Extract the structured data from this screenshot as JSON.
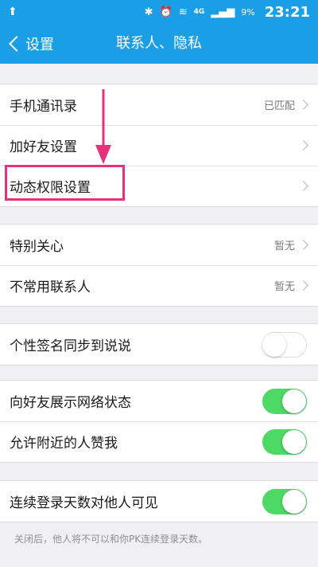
{
  "status_bar": {
    "upload_glyph": "⬆",
    "bluetooth_glyph": "✱",
    "alarm_glyph": "⏰",
    "wifi_glyph": "≋",
    "network_label": "4G",
    "signal_glyph": "▂▄▆",
    "battery": "9%",
    "time": "23:21"
  },
  "nav": {
    "back_label": "设置",
    "title": "联系人、隐私"
  },
  "groups": {
    "contacts": [
      {
        "label": "手机通讯录",
        "value": "已匹配"
      },
      {
        "label": "加好友设置",
        "value": ""
      },
      {
        "label": "动态权限设置",
        "value": ""
      }
    ],
    "special": [
      {
        "label": "特别关心",
        "value": "暂无"
      },
      {
        "label": "不常用联系人",
        "value": "暂无"
      }
    ],
    "signature": {
      "label": "个性签名同步到说说",
      "on": false
    },
    "visibility": [
      {
        "label": "向好友展示网络状态",
        "on": true
      },
      {
        "label": "允许附近的人赞我",
        "on": true
      }
    ],
    "login_days": {
      "label": "连续登录天数对他人可见",
      "on": true
    }
  },
  "hint": "关闭后，他人将不可以和你PK连续登录天数。",
  "colors": {
    "nav_blue": "#1a9ee6",
    "toggle_on": "#4cd964",
    "highlight": "#e8317a"
  }
}
